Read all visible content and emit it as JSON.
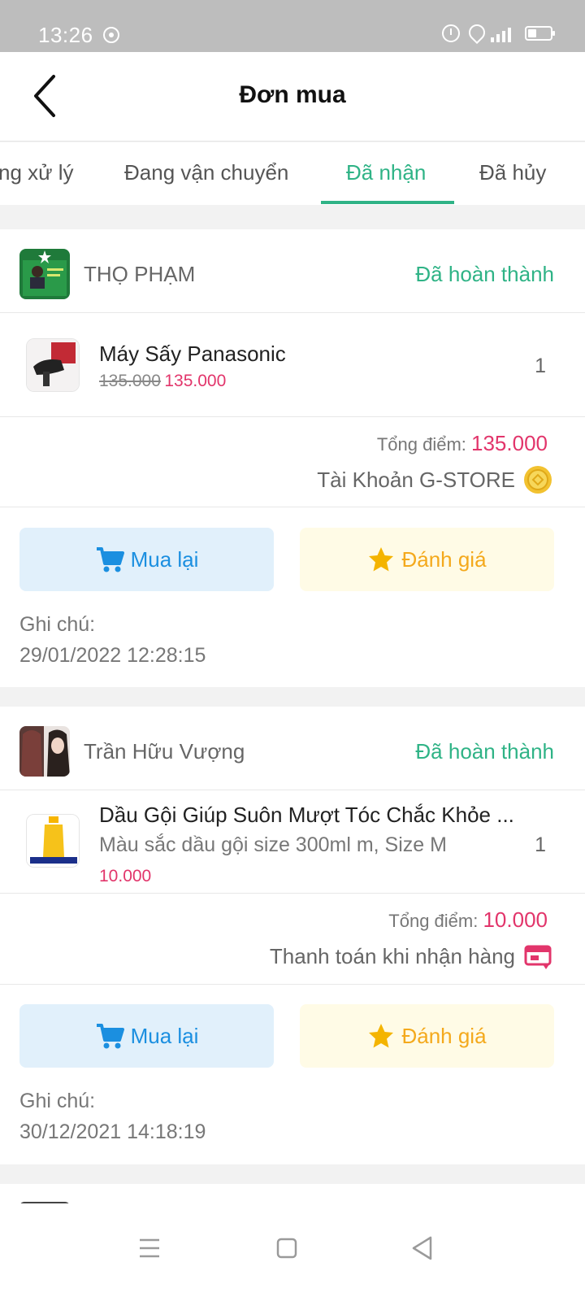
{
  "status_bar": {
    "time": "13:26"
  },
  "header": {
    "title": "Đơn mua"
  },
  "tabs": [
    {
      "label": "ng xử lý",
      "active": false
    },
    {
      "label": "Đang vận chuyển",
      "active": false
    },
    {
      "label": "Đã nhận",
      "active": true
    },
    {
      "label": "Đã hủy",
      "active": false
    }
  ],
  "colors": {
    "accent": "#2fb386",
    "price": "#e2356b",
    "rebuy": "#1b8fe0",
    "review": "#f4a91c"
  },
  "orders": [
    {
      "shop_name": "THỌ PHẠM",
      "status": "Đã hoàn thành",
      "product": {
        "name": "Máy Sấy Panasonic",
        "price_old": "135.000",
        "price_new": "135.000",
        "qty": "1"
      },
      "total_label": "Tổng điểm:",
      "total_value": "135.000",
      "payment": "Tài Khoản G-STORE",
      "payment_icon": "coin-icon",
      "rebuy_label": "Mua lại",
      "review_label": "Đánh giá",
      "note_label": "Ghi chú:",
      "date": "29/01/2022 12:28:15"
    },
    {
      "shop_name": "Trần Hữu Vượng",
      "status": "Đã hoàn thành",
      "product": {
        "name": "Dầu Gội Giúp Suôn Mượt Tóc Chắc Khỏe ...",
        "variant": "Màu sắc dầu gội size 300ml m, Size M",
        "price_new": "10.000",
        "qty": "1"
      },
      "total_label": "Tổng điểm:",
      "total_value": "10.000",
      "payment": "Thanh toán khi nhận hàng",
      "payment_icon": "cash-on-delivery-icon",
      "rebuy_label": "Mua lại",
      "review_label": "Đánh giá",
      "note_label": "Ghi chú:",
      "date": "30/12/2021 14:18:19"
    }
  ]
}
